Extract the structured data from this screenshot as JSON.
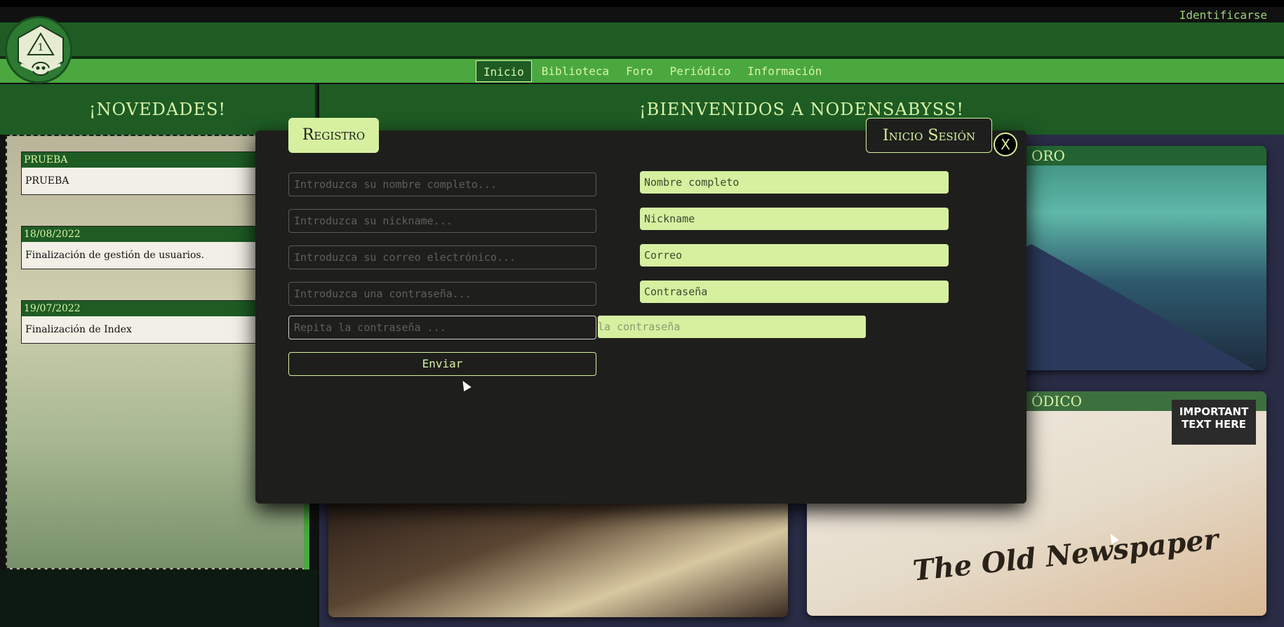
{
  "topbar": {
    "login_link": "Identificarse"
  },
  "logo": {
    "die_number": "1"
  },
  "nav": {
    "items": [
      {
        "label": "Inicio",
        "active": true
      },
      {
        "label": "Biblioteca"
      },
      {
        "label": "Foro"
      },
      {
        "label": "Periódico"
      },
      {
        "label": "Información"
      }
    ]
  },
  "left_section": {
    "title": "¡NOVEDADES!",
    "items": [
      {
        "date": "PRUEBA",
        "text": "PRUEBA"
      },
      {
        "date": "18/08/2022",
        "text": "Finalización de gestión de usuarios."
      },
      {
        "date": "19/07/2022",
        "text": "Finalización de Index"
      }
    ]
  },
  "main_section": {
    "title": "¡BIENVENIDOS A NODENSABYSS!",
    "cards": {
      "foro_label": "ORO",
      "periodico_label": "ÓDICO",
      "newspaper_title": "The Old Newspaper",
      "newspaper_box": "IMPORTANT TEXT HERE"
    }
  },
  "modal": {
    "tab_register": "Registro",
    "tab_login": "Inicio Sesión",
    "close_label": "X",
    "register_fields": [
      {
        "placeholder": "Introduzca su nombre completo..."
      },
      {
        "placeholder": "Introduzca su nickname..."
      },
      {
        "placeholder": "Introduzca su correo electrónico..."
      },
      {
        "placeholder": "Introduzca una contraseña..."
      },
      {
        "placeholder": "Repita la contraseña ..."
      }
    ],
    "login_fields": [
      {
        "label": "Nombre completo"
      },
      {
        "label": "Nickname"
      },
      {
        "label": "Correo"
      },
      {
        "label": "Contraseña"
      }
    ],
    "ghost_field": "la contraseña",
    "submit_label": "Enviar"
  },
  "colors": {
    "accent_dark": "#1e5c24",
    "accent_light": "#4aa83f",
    "pale_green": "#d6f0a0",
    "modal_bg": "#1e1f1c"
  }
}
